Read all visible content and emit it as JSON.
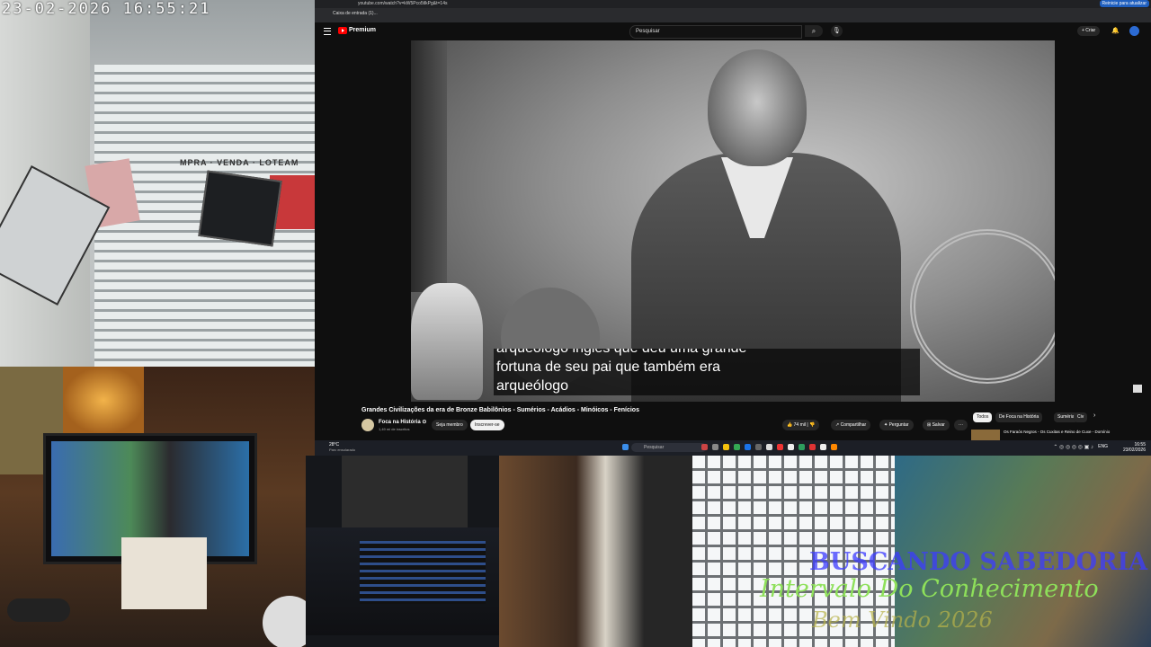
{
  "overlay": {
    "timestamp": "23-02-2026  16:55:21",
    "line1": "BUSCANDO SABEDORIA",
    "line2": "Intervalo Do Conhecimento",
    "line3": "Bem Vindo 2026",
    "street_sign": "MPRA · VENDA · LOTEAM"
  },
  "browser": {
    "url": "youtube.com/watch?v=kW5Pco5tlkPg&t=14s",
    "bookmark": "Caixa de entrada (1)...",
    "update_label": "Reinicie para atualizar",
    "brand": "Premium",
    "search_placeholder": "Pesquisar",
    "create_label": "+ Criar"
  },
  "video": {
    "subtitle_line0": "arqueólogo inglês que deu uma grande",
    "subtitle_line1": "fortuna de seu pai que também era",
    "subtitle_line2": "arqueólogo",
    "title": "Grandes Civilizações da era de Bronze Babilônios - Sumérios - Acádios - Minóicos - Fenícios",
    "channel": "Foca na História ⊙",
    "subscribers": "1,49 mi de inscritos",
    "join_label": "Seja membro",
    "subscribe_label": "Inscrever-se",
    "likes": "74 mil",
    "share_label": "Compartilhar",
    "ask_label": "Perguntar",
    "save_label": "Salvar",
    "more_label": "···"
  },
  "chips": [
    "Todos",
    "De Foca na História",
    "Suméria",
    "Civ"
  ],
  "recommendation": {
    "title": "Os Faraós Negros - Os Cuxitas e Reino de Cuxe - Domínio"
  },
  "taskbar": {
    "weather_temp": "28°C",
    "weather_desc": "Parc ensolarado",
    "search_label": "Pesquisar",
    "lang": "ENG",
    "time": "16:55",
    "date": "23/02/2026"
  },
  "colors": {
    "yt_red": "#ff0000",
    "overlay_blue": "#3c3cff",
    "overlay_green": "#8ee05a",
    "overlay_gold": "#b8b34a"
  }
}
